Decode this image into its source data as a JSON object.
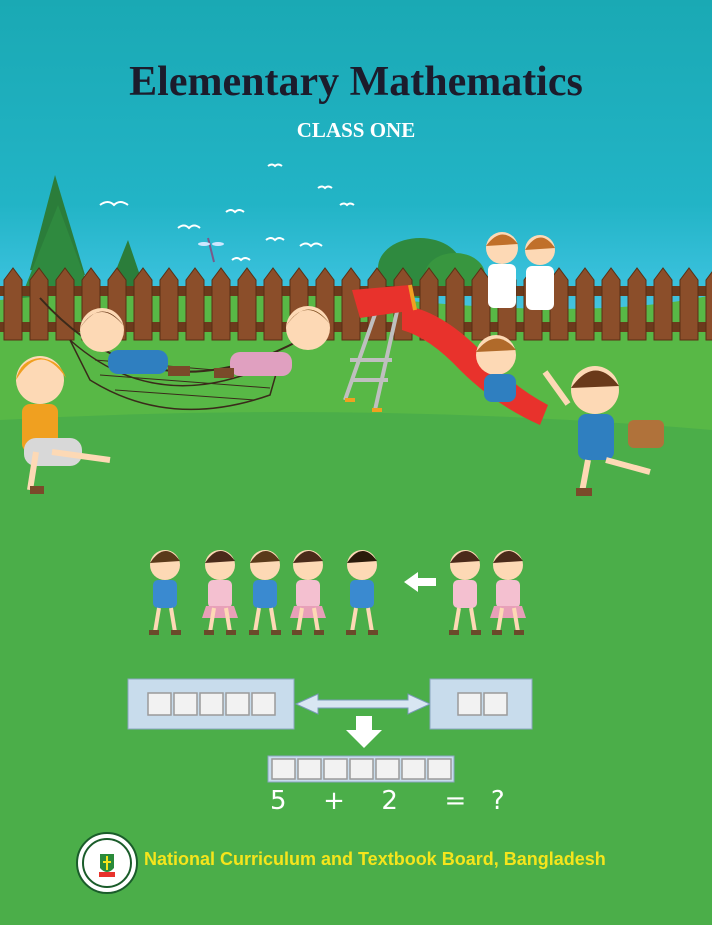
{
  "cover": {
    "title": "Elementary Mathematics",
    "subtitle": "CLASS ONE",
    "equation": {
      "a": "5",
      "plus": "+",
      "b": "2",
      "equals": "=",
      "result": "?"
    },
    "left_group_count": 5,
    "right_group_count": 2,
    "total_count": 7,
    "publisher": "National Curriculum and Textbook Board, Bangladesh"
  },
  "colors": {
    "sky": "#22b4c6",
    "grass": "#4bb04a",
    "fence": "#8b4e2a",
    "slide": "#e8322c",
    "title": "#1c1c2c",
    "publisher": "#f5e51c"
  }
}
